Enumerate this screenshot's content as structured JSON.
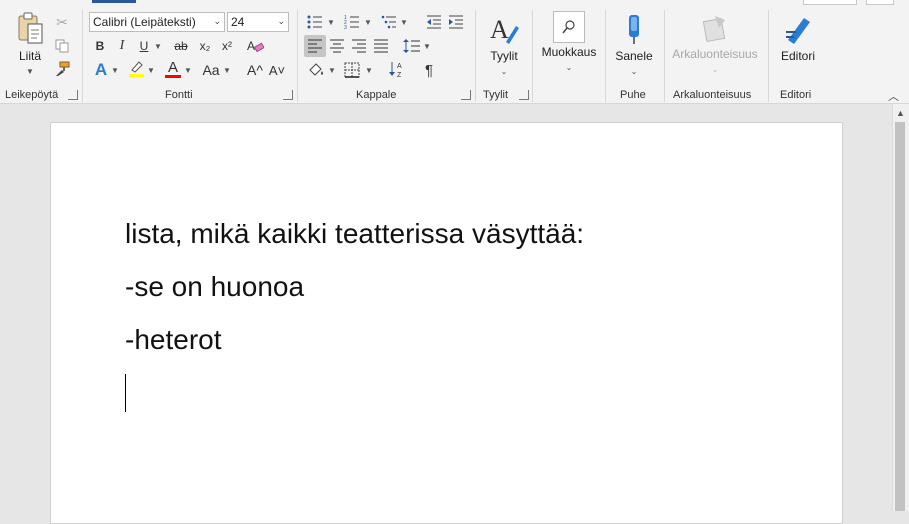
{
  "ribbon": {
    "clipboard": {
      "paste_label": "Liitä",
      "group_label": "Leikepöytä"
    },
    "font": {
      "group_label": "Fontti",
      "font_name": "Calibri (Leipäteksti)",
      "font_size": "24",
      "bold": "B",
      "italic": "I",
      "underline": "U",
      "strike": "ab",
      "subscript": "x₂",
      "superscript": "x²",
      "text_effects": "A",
      "highlight": "ab",
      "font_color": "A",
      "change_case": "Aa",
      "grow": "A^",
      "shrink": "A˅",
      "colors": {
        "highlight": "#ffff00",
        "font_color": "#ff0000",
        "accent": "#2b579a"
      }
    },
    "paragraph": {
      "group_label": "Kappale",
      "pilcrow": "¶"
    },
    "styles": {
      "label": "Tyylit",
      "group_label": "Tyylit"
    },
    "editing": {
      "label": "Muokkaus"
    },
    "voice": {
      "label": "Sanele",
      "group_label": "Puhe"
    },
    "sensitivity": {
      "label": "Arkaluonteisuus",
      "group_label": "Arkaluonteisuus"
    },
    "editor": {
      "label": "Editori",
      "group_label": "Editori"
    }
  },
  "document": {
    "lines": [
      "lista, mikä kaikki teatterissa väsyttää:",
      "-se on huonoa",
      "-heterot"
    ]
  }
}
